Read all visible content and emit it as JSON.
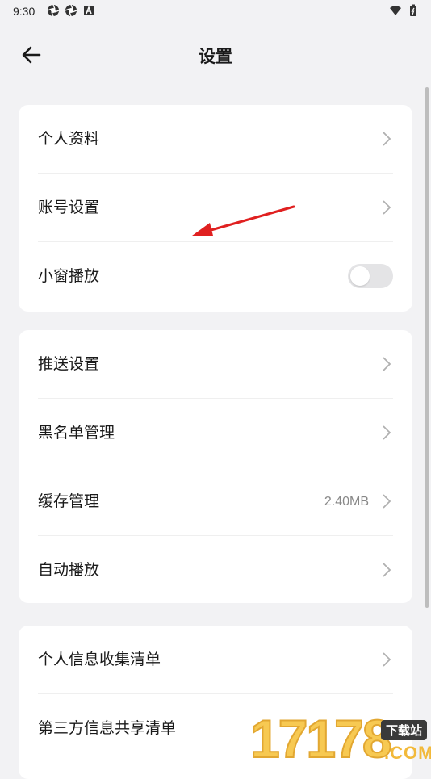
{
  "status_bar": {
    "time": "9:30",
    "left_icons": [
      "aperture-icon",
      "aperture-icon",
      "a-box-icon"
    ],
    "right_icons": [
      "wifi-icon",
      "battery-icon"
    ]
  },
  "header": {
    "back_icon": "arrow-left-icon",
    "title": "设置"
  },
  "sections": [
    {
      "items": [
        {
          "label": "个人资料",
          "type": "link"
        },
        {
          "label": "账号设置",
          "type": "link"
        },
        {
          "label": "小窗播放",
          "type": "toggle",
          "on": false
        }
      ]
    },
    {
      "items": [
        {
          "label": "推送设置",
          "type": "link"
        },
        {
          "label": "黑名单管理",
          "type": "link"
        },
        {
          "label": "缓存管理",
          "type": "link",
          "value": "2.40MB"
        },
        {
          "label": "自动播放",
          "type": "link"
        }
      ]
    },
    {
      "items": [
        {
          "label": "个人信息收集清单",
          "type": "link"
        },
        {
          "label": "第三方信息共享清单",
          "type": "link"
        }
      ]
    }
  ],
  "watermark": {
    "number": "17178",
    "badge": "下载站",
    "suffix": ".COM"
  },
  "colors": {
    "background": "#f2f2f4",
    "card": "#ffffff",
    "annotation_arrow": "#e02020",
    "toggle_off": "#e4e4e6"
  }
}
